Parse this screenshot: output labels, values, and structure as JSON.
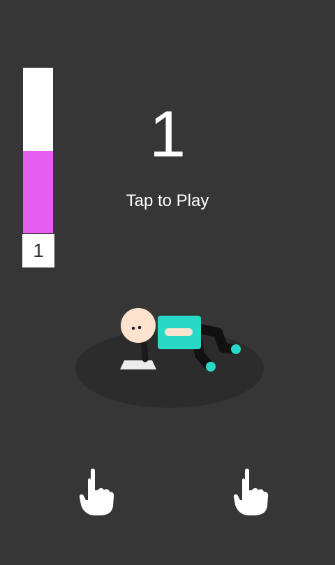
{
  "hud": {
    "score": "1",
    "level": "1",
    "prompt": "Tap to Play"
  },
  "meter": {
    "fill_fraction": 0.5,
    "fill_color": "#e55ef0",
    "empty_color": "#ffffff"
  },
  "colors": {
    "background": "#373636",
    "floor_shadow": "#2d2c2c",
    "player_shirt": "#29d9c8",
    "player_skin": "#fde3cd"
  },
  "controls": {
    "left_icon": "pointing-hand-icon",
    "right_icon": "pointing-hand-icon"
  }
}
